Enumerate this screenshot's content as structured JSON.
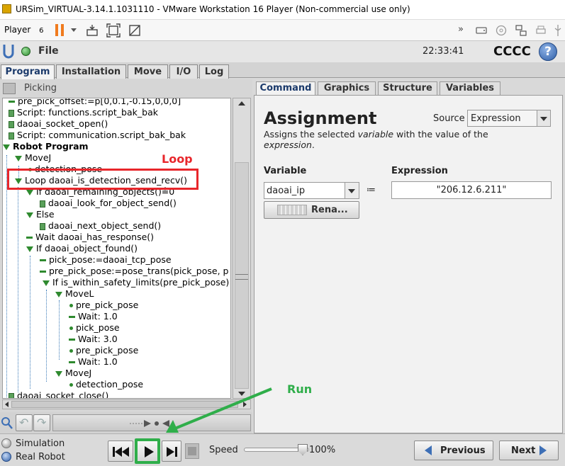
{
  "window": {
    "title": "URSim_VIRTUAL-3.14.1.1031110 - VMware Workstation 16 Player (Non-commercial use only)"
  },
  "toolbar": {
    "player_label": "Player",
    "player_count": "6"
  },
  "header": {
    "file_label": "File",
    "clock": "22:33:41",
    "robot_name": "CCCC",
    "help_symbol": "?"
  },
  "main_tabs": [
    "Program",
    "Installation",
    "Move",
    "I/O",
    "Log"
  ],
  "program_name": "Picking",
  "tree": [
    "pre_pick_offset:=p[0,0.1,-0.15,0,0,0]",
    "Script: functions.script_bak_bak",
    "daoai_socket_open()",
    "Script: communication.script_bak_bak",
    "Robot Program",
    "MoveJ",
    "detection_pose",
    "Loop daoai_is_detection_send_recv()",
    "If daoai_remaining_objects()≟0",
    "daoai_look_for_object_send()",
    "Else",
    "daoai_next_object_send()",
    "Wait daoai_has_response()",
    "If daoai_object_found()",
    "pick_pose:=daoai_tcp_pose",
    "pre_pick_pose:=pose_trans(pick_pose, p",
    "If is_within_safety_limits(pre_pick_pose)",
    "MoveL",
    "pre_pick_pose",
    "Wait: 1.0",
    "pick_pose",
    "Wait: 3.0",
    "pre_pick_pose",
    "Wait: 1.0",
    "MoveJ",
    "detection_pose",
    "daoai_socket_close()"
  ],
  "annotations": {
    "loop_label": "Loop",
    "run_label": "Run"
  },
  "right_tabs": [
    "Command",
    "Graphics",
    "Structure",
    "Variables"
  ],
  "assignment": {
    "title": "Assignment",
    "source_label": "Source",
    "source_value": "Expression",
    "desc_part1": "Assigns the selected ",
    "desc_italic1": "variable",
    "desc_part2": " with the value of the ",
    "desc_italic2": "expression",
    "desc_part3": ".",
    "variable_label": "Variable",
    "variable_value": "daoai_ip",
    "assign_op": "≔",
    "expression_label": "Expression",
    "expression_value": "\"206.12.6.211\"",
    "rename_button": "Rena..."
  },
  "footer": {
    "simulation_label": "Simulation",
    "real_robot_label": "Real Robot",
    "speed_label": "Speed",
    "speed_value_text": "100%",
    "speed_fraction": 1.0,
    "previous_label": "Previous",
    "next_label": "Next"
  },
  "colors": {
    "annotation_red": "#e8262b",
    "annotation_green": "#2fae4a",
    "ur_blue": "#3d6fb6",
    "status_green": "#3aa63a"
  }
}
